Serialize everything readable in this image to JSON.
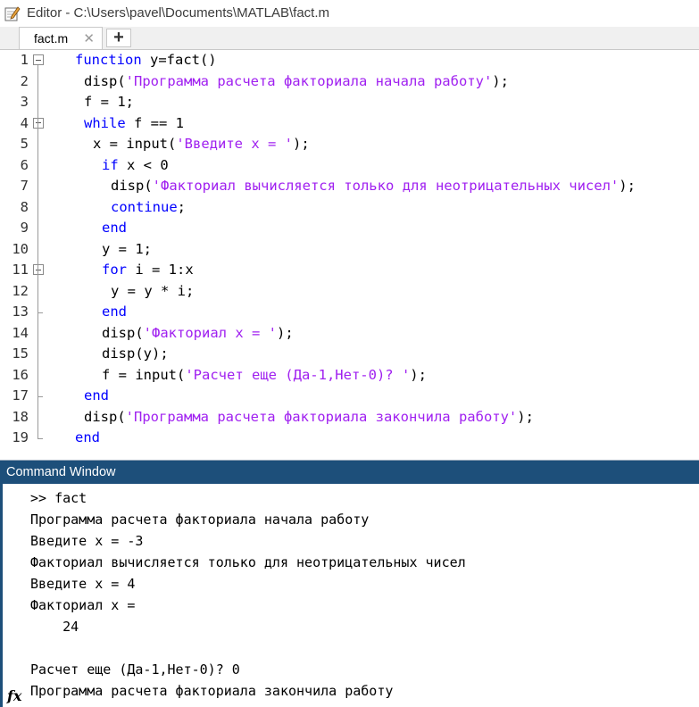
{
  "window": {
    "title": "Editor - C:\\Users\\pavel\\Documents\\MATLAB\\fact.m",
    "icon": "pencil-note-icon"
  },
  "tabs": [
    {
      "label": "fact.m",
      "close": "✕",
      "active": true
    }
  ],
  "add_tab_label": "+",
  "editor": {
    "lines": [
      {
        "num": "1",
        "indent": 0,
        "tokens": [
          [
            "kw",
            "function"
          ],
          [
            "plain",
            " y=fact()"
          ]
        ]
      },
      {
        "num": "2",
        "indent": 1,
        "tokens": [
          [
            "plain",
            "disp("
          ],
          [
            "str",
            "'Программа расчета факториала начала работу'"
          ],
          [
            "plain",
            ");"
          ]
        ]
      },
      {
        "num": "3",
        "indent": 1,
        "tokens": [
          [
            "plain",
            "f = 1;"
          ]
        ]
      },
      {
        "num": "4",
        "indent": 1,
        "tokens": [
          [
            "kw",
            "while"
          ],
          [
            "plain",
            " f == 1"
          ]
        ]
      },
      {
        "num": "5",
        "indent": 2,
        "tokens": [
          [
            "plain",
            "x = input("
          ],
          [
            "str",
            "'Введите x = '"
          ],
          [
            "plain",
            ");"
          ]
        ]
      },
      {
        "num": "6",
        "indent": 3,
        "tokens": [
          [
            "kw",
            "if"
          ],
          [
            "plain",
            " x < 0"
          ]
        ]
      },
      {
        "num": "7",
        "indent": 4,
        "tokens": [
          [
            "plain",
            "disp("
          ],
          [
            "str",
            "'Факториал вычисляется только для неотрицательных чисел'"
          ],
          [
            "plain",
            ");"
          ]
        ]
      },
      {
        "num": "8",
        "indent": 4,
        "tokens": [
          [
            "kw",
            "continue"
          ],
          [
            "plain",
            ";"
          ]
        ]
      },
      {
        "num": "9",
        "indent": 3,
        "tokens": [
          [
            "kw",
            "end"
          ]
        ]
      },
      {
        "num": "10",
        "indent": 3,
        "tokens": [
          [
            "plain",
            "y = 1;"
          ]
        ]
      },
      {
        "num": "11",
        "indent": 3,
        "tokens": [
          [
            "kw",
            "for"
          ],
          [
            "plain",
            " i = 1:x"
          ]
        ]
      },
      {
        "num": "12",
        "indent": 4,
        "tokens": [
          [
            "plain",
            "y = y * i;"
          ]
        ]
      },
      {
        "num": "13",
        "indent": 3,
        "tokens": [
          [
            "kw",
            "end"
          ]
        ]
      },
      {
        "num": "14",
        "indent": 3,
        "tokens": [
          [
            "plain",
            "disp("
          ],
          [
            "str",
            "'Факториал x = '"
          ],
          [
            "plain",
            ");"
          ]
        ]
      },
      {
        "num": "15",
        "indent": 3,
        "tokens": [
          [
            "plain",
            "disp(y);"
          ]
        ]
      },
      {
        "num": "16",
        "indent": 3,
        "tokens": [
          [
            "plain",
            "f = input("
          ],
          [
            "str",
            "'Расчет еще (Да-1,Нет-0)? '"
          ],
          [
            "plain",
            ");"
          ]
        ]
      },
      {
        "num": "17",
        "indent": 1,
        "tokens": [
          [
            "kw",
            "end"
          ]
        ]
      },
      {
        "num": "18",
        "indent": 1,
        "tokens": [
          [
            "plain",
            "disp("
          ],
          [
            "str",
            "'Программа расчета факториала закончила работу'"
          ],
          [
            "plain",
            ");"
          ]
        ]
      },
      {
        "num": "19",
        "indent": 0,
        "tokens": [
          [
            "kw",
            "end"
          ]
        ]
      }
    ]
  },
  "command_window": {
    "title": "Command Window",
    "lines": [
      ">> fact",
      "Программа расчета факториала начала работу",
      "Введите x = -3",
      "Факториал вычисляется только для неотрицательных чисел",
      "Введите x = 4",
      "Факториал x =",
      "    24",
      "",
      "Расчет еще (Да-1,Нет-0)? 0",
      "Программа расчета факториала закончила работу"
    ],
    "prompt_icon": "fx"
  },
  "colors": {
    "keyword": "#0000ff",
    "string": "#a020f0",
    "header_bg": "#1d4f7a"
  }
}
